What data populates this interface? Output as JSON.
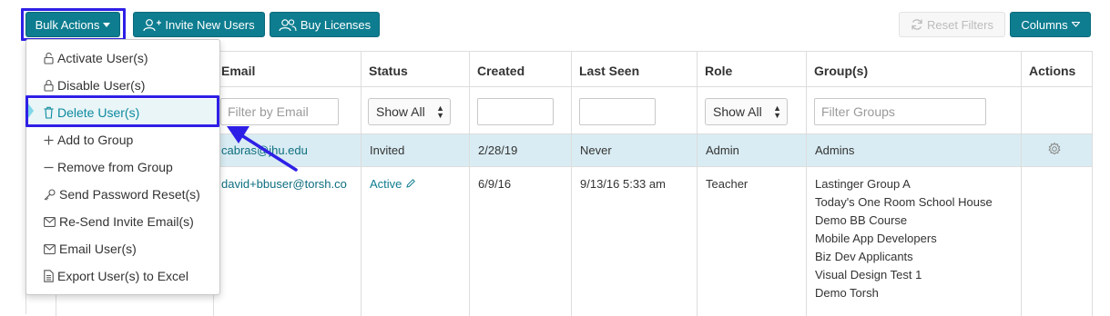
{
  "toolbar": {
    "bulk_actions": "Bulk Actions",
    "invite_new_users": "Invite New Users",
    "buy_licenses": "Buy Licenses",
    "reset_filters": "Reset Filters",
    "columns": "Columns"
  },
  "bulk_menu": {
    "items": [
      {
        "label": "Activate User(s)",
        "icon": "lock-open-icon"
      },
      {
        "label": "Disable User(s)",
        "icon": "lock-icon"
      },
      {
        "label": "Delete User(s)",
        "icon": "trash-icon"
      },
      {
        "label": "Add to Group",
        "icon": "plus-icon"
      },
      {
        "label": "Remove from Group",
        "icon": "minus-icon"
      },
      {
        "label": "Send Password Reset(s)",
        "icon": "key-icon"
      },
      {
        "label": "Re-Send Invite Email(s)",
        "icon": "envelope-icon"
      },
      {
        "label": "Email User(s)",
        "icon": "envelope-icon"
      },
      {
        "label": "Export User(s) to Excel",
        "icon": "file-icon"
      }
    ]
  },
  "table": {
    "headers": {
      "email": "Email",
      "status": "Status",
      "created": "Created",
      "last_seen": "Last Seen",
      "role": "Role",
      "groups": "Group(s)",
      "actions": "Actions"
    },
    "filters": {
      "email_placeholder": "Filter by Email",
      "status_value": "Show All",
      "role_value": "Show All",
      "groups_placeholder": "Filter Groups"
    },
    "rows": [
      {
        "email": "cabras@jhu.edu",
        "status": "Invited",
        "created": "2/28/19",
        "last_seen": "Never",
        "role": "Admin",
        "groups": [
          "Admins"
        ]
      },
      {
        "email": "david+bbuser@torsh.co",
        "status": "Active",
        "created": "6/9/16",
        "last_seen": "9/13/16 5:33 am",
        "role": "Teacher",
        "groups": [
          "Lastinger Group A",
          "Today's One Room School House",
          "Demo BB Course",
          "Mobile App Developers",
          "Biz Dev Applicants",
          "Visual Design Test 1",
          "Demo Torsh"
        ]
      }
    ]
  },
  "colors": {
    "primary": "#0e7d90",
    "highlight": "#2e1fe6",
    "selected_row": "#d9ecf3"
  }
}
